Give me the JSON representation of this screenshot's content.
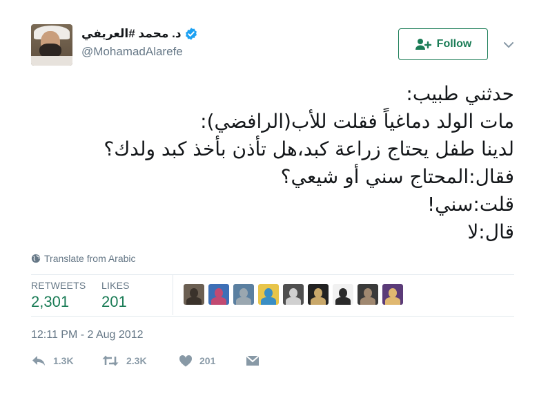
{
  "user": {
    "display_name": "د. محمد #العريفي",
    "handle": "@MohamadAlarefe",
    "verified": true
  },
  "follow_button": {
    "label": "Follow"
  },
  "tweet": {
    "lines": [
      "حدثني طبيب:",
      "مات الولد دماغياً فقلت للأب(الرافضي):",
      "لدينا طفل يحتاج زراعة كبد،هل تأذن بأخذ كبد ولدك؟",
      "فقال:المحتاج سني أو شيعي؟",
      "قلت:سني!",
      "قال:لا"
    ],
    "translate_label": "Translate from Arabic",
    "timestamp": "12:11 PM - 2 Aug 2012"
  },
  "stats": {
    "retweets": {
      "label": "RETWEETS",
      "value": "2,301"
    },
    "likes": {
      "label": "LIKES",
      "value": "201"
    }
  },
  "likers": [
    {
      "name": "liker-1",
      "bg": "#6b5f52",
      "fg": "#3a322b"
    },
    {
      "name": "liker-2",
      "bg": "#3d6fb6",
      "fg": "#c24a72"
    },
    {
      "name": "liker-3",
      "bg": "#5a7fa0",
      "fg": "#9aa7b0"
    },
    {
      "name": "liker-4",
      "bg": "#e8c54a",
      "fg": "#3a8ec4"
    },
    {
      "name": "liker-5",
      "bg": "#4f4f4f",
      "fg": "#d0d0d0"
    },
    {
      "name": "liker-6",
      "bg": "#222222",
      "fg": "#c9a86a"
    },
    {
      "name": "liker-7",
      "bg": "#f1f1f1",
      "fg": "#2a2a2a"
    },
    {
      "name": "liker-8",
      "bg": "#3a3a3a",
      "fg": "#a08870"
    },
    {
      "name": "liker-9",
      "bg": "#5b3b78",
      "fg": "#e0b870"
    }
  ],
  "actions": {
    "reply_count": "1.3K",
    "retweet_count": "2.3K",
    "like_count": "201"
  },
  "colors": {
    "accent": "#1a7c56",
    "verified": "#1da1f2",
    "muted": "#657786"
  }
}
